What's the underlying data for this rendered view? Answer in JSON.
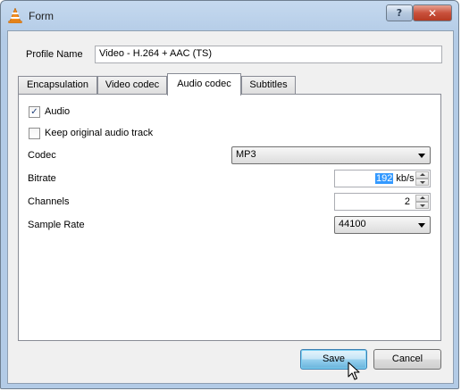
{
  "window": {
    "title": "Form"
  },
  "profile": {
    "label": "Profile Name",
    "value": "Video - H.264 + AAC (TS)"
  },
  "tabs": [
    {
      "label": "Encapsulation"
    },
    {
      "label": "Video codec"
    },
    {
      "label": "Audio codec"
    },
    {
      "label": "Subtitles"
    }
  ],
  "active_tab": "Audio codec",
  "audio": {
    "audio_checkbox": {
      "label": "Audio",
      "checked": true,
      "mark": "✓"
    },
    "keep_original": {
      "label": "Keep original audio track",
      "checked": false
    },
    "codec": {
      "label": "Codec",
      "value": "MP3"
    },
    "bitrate": {
      "label": "Bitrate",
      "value": "192",
      "unit": "kb/s"
    },
    "channels": {
      "label": "Channels",
      "value": "2"
    },
    "sample_rate": {
      "label": "Sample Rate",
      "value": "44100"
    }
  },
  "buttons": {
    "save": "Save",
    "cancel": "Cancel"
  },
  "icons": {
    "app": "vlc-cone-icon",
    "help": "?",
    "close": "✕"
  },
  "colors": {
    "accent": "#3399ff",
    "cone_orange": "#f28c1e",
    "close_red": "#c9513c"
  }
}
